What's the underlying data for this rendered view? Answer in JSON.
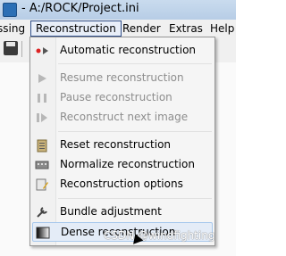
{
  "window": {
    "title": "- A:/ROCK/Project.ini"
  },
  "menubar": {
    "items": [
      {
        "label": "ssing"
      },
      {
        "label": "Reconstruction"
      },
      {
        "label": "Render"
      },
      {
        "label": "Extras"
      },
      {
        "label": "Help"
      }
    ]
  },
  "dropdown": {
    "items": [
      {
        "label": "Automatic reconstruction",
        "icon": "play-record-icon"
      },
      {
        "label": "Resume reconstruction",
        "icon": "play-icon"
      },
      {
        "label": "Pause reconstruction",
        "icon": "pause-icon"
      },
      {
        "label": "Reconstruct next image",
        "icon": "step-icon"
      },
      {
        "label": "Reset reconstruction",
        "icon": "clipboard-icon"
      },
      {
        "label": "Normalize reconstruction",
        "icon": "keyboard-icon"
      },
      {
        "label": "Reconstruction options",
        "icon": "edit-options-icon"
      },
      {
        "label": "Bundle adjustment",
        "icon": "wrench-icon"
      },
      {
        "label": "Dense reconstruction",
        "icon": "gradient-icon"
      }
    ]
  },
  "watermark": "CSDN @windfighting"
}
